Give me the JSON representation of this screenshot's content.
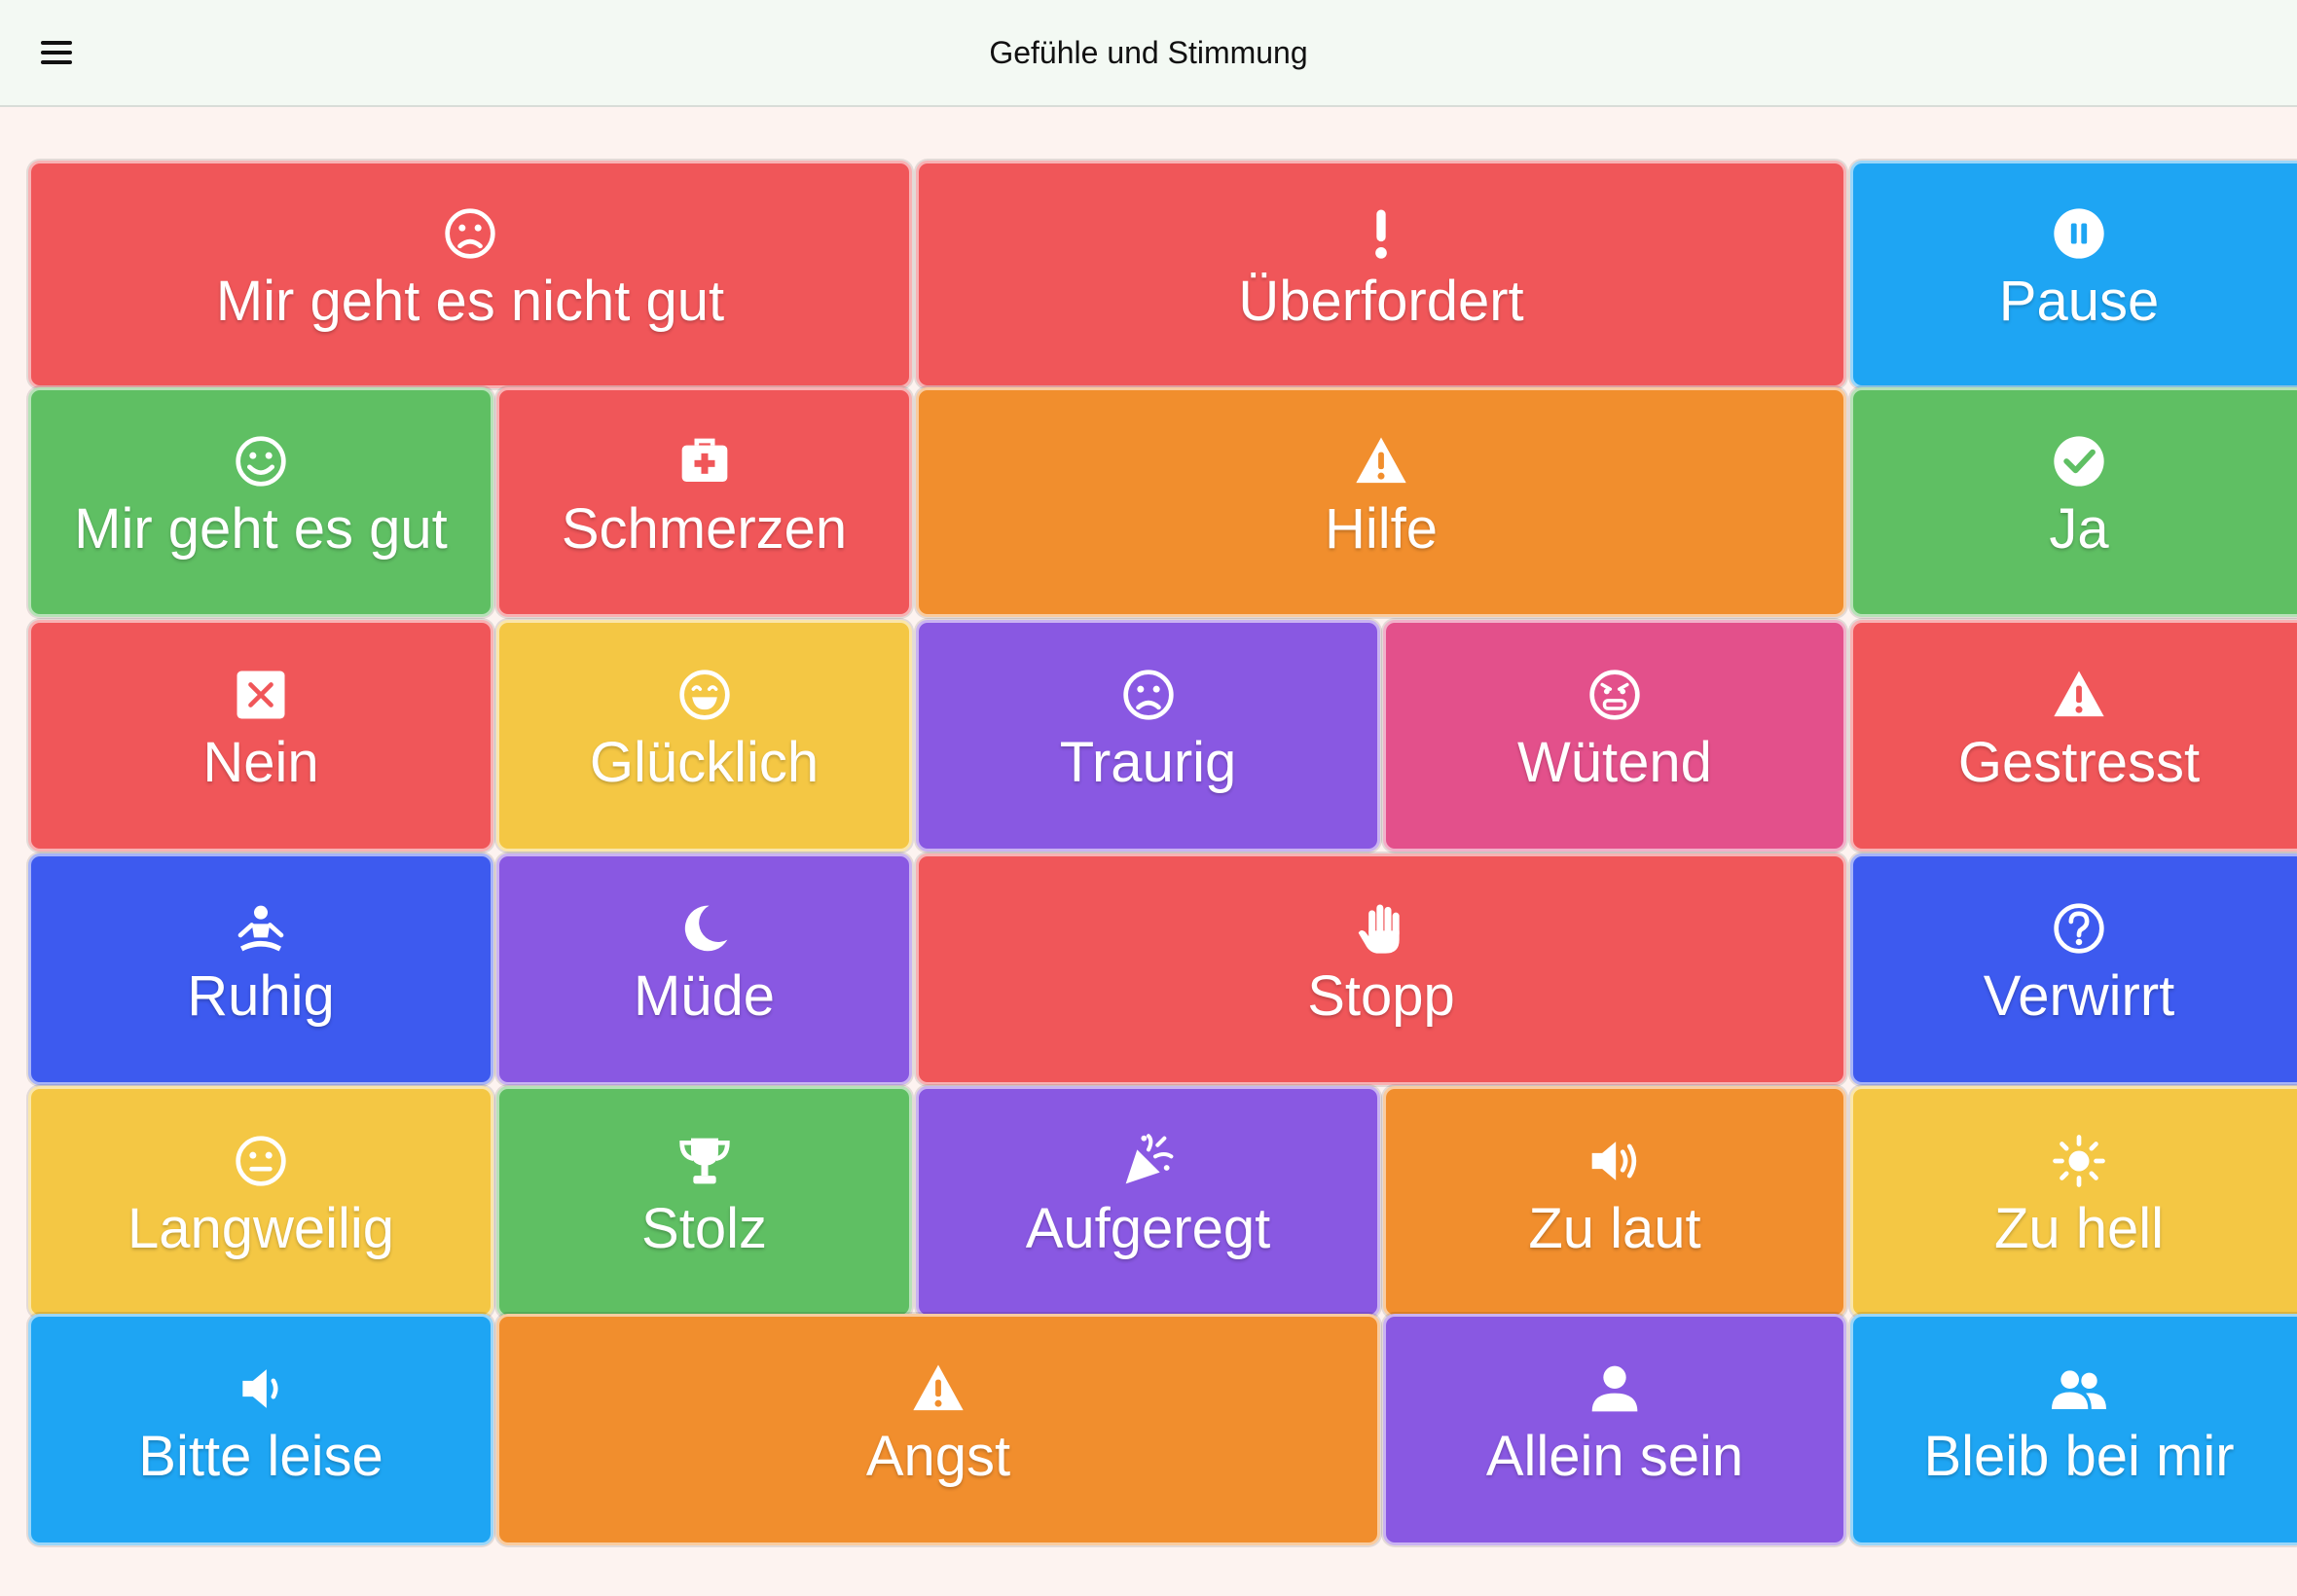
{
  "header": {
    "title": "Gefühle und Stimmung",
    "menu_icon": "menu-icon"
  },
  "colors": {
    "red": "#f05659",
    "blue": "#1ea5f3",
    "green": "#5fbf63",
    "orange": "#f18e2d",
    "purple": "#8958e2",
    "pink": "#e3508b",
    "yellow": "#f4c744",
    "indigo": "#3d5aef"
  },
  "tiles": [
    {
      "label": "Mir geht es nicht gut",
      "icon": "sad-face-icon"
    },
    {
      "label": "Überfordert",
      "icon": "exclamation-icon"
    },
    {
      "label": "Pause",
      "icon": "pause-icon"
    },
    {
      "label": "Mir geht es gut",
      "icon": "smile-face-icon"
    },
    {
      "label": "Schmerzen",
      "icon": "first-aid-kit-icon"
    },
    {
      "label": "Hilfe",
      "icon": "warning-icon"
    },
    {
      "label": "Ja",
      "icon": "check-circle-icon"
    },
    {
      "label": "Nein",
      "icon": "x-square-icon"
    },
    {
      "label": "Glücklich",
      "icon": "grin-face-icon"
    },
    {
      "label": "Traurig",
      "icon": "sad-face-icon"
    },
    {
      "label": "Wütend",
      "icon": "angry-face-icon"
    },
    {
      "label": "Gestresst",
      "icon": "warning-icon"
    },
    {
      "label": "Ruhig",
      "icon": "meditation-icon"
    },
    {
      "label": "Müde",
      "icon": "moon-icon"
    },
    {
      "label": "Stopp",
      "icon": "hand-icon"
    },
    {
      "label": "Verwirrt",
      "icon": "question-circle-icon"
    },
    {
      "label": "Langweilig",
      "icon": "neutral-face-icon"
    },
    {
      "label": "Stolz",
      "icon": "trophy-icon"
    },
    {
      "label": "Aufgeregt",
      "icon": "party-popper-icon"
    },
    {
      "label": "Zu laut",
      "icon": "volume-up-icon"
    },
    {
      "label": "Zu hell",
      "icon": "sun-icon"
    },
    {
      "label": "Bitte leise",
      "icon": "volume-low-icon"
    },
    {
      "label": "Angst",
      "icon": "warning-icon"
    },
    {
      "label": "Allein sein",
      "icon": "person-icon"
    },
    {
      "label": "Bleib bei mir",
      "icon": "people-icon"
    }
  ]
}
